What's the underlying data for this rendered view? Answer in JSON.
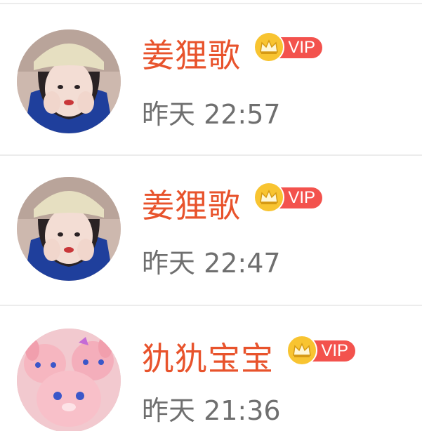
{
  "comments": [
    {
      "name": "姜狸歌",
      "vip_label": "VIP",
      "time": "昨天 22:57",
      "avatar_icon": "girl-avatar",
      "name_color": "#e8532c"
    },
    {
      "name": "姜狸歌",
      "vip_label": "VIP",
      "time": "昨天 22:47",
      "avatar_icon": "girl-avatar",
      "name_color": "#e8532c"
    },
    {
      "name": "犰犰宝宝",
      "vip_label": "VIP",
      "time": "昨天 21:36",
      "avatar_icon": "plush-avatar",
      "name_color": "#e8532c"
    }
  ],
  "colors": {
    "vip_pill": "#f3524d",
    "crown": "#f8c431",
    "time_text": "#6f6f6f",
    "divider": "#ececec"
  }
}
